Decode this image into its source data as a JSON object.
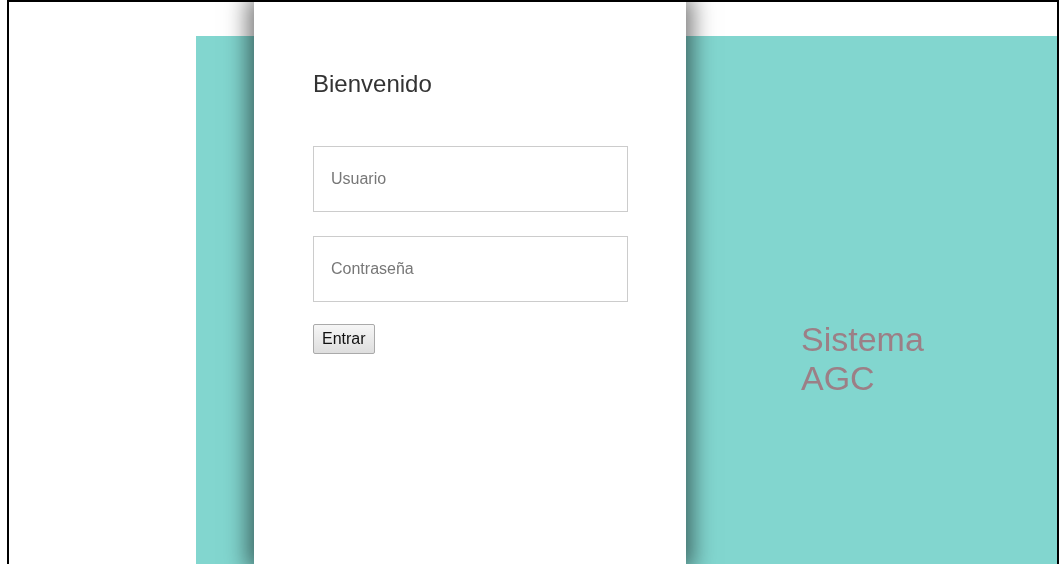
{
  "login": {
    "title": "Bienvenido",
    "fields": [
      {
        "placeholder": "Usuario"
      },
      {
        "placeholder": "Contraseña"
      }
    ],
    "button": "Entrar"
  },
  "banner": {
    "text": "Sistema AGC"
  }
}
